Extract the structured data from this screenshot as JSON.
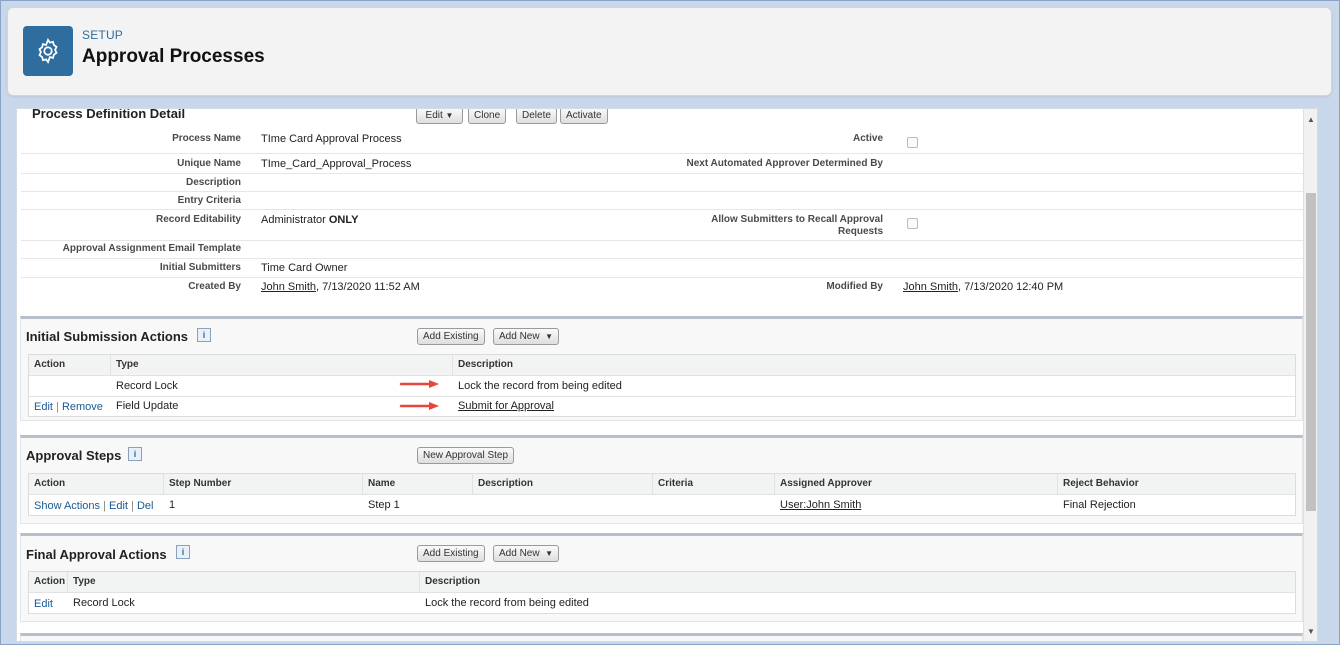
{
  "header": {
    "breadcrumb": "SETUP",
    "title": "Approval Processes",
    "icon": "gear-icon"
  },
  "detail": {
    "section_title": "Process Definition Detail",
    "buttons": {
      "edit": "Edit",
      "clone": "Clone",
      "delete": "Delete",
      "activate": "Activate"
    },
    "fields": {
      "process_name_label": "Process Name",
      "process_name": "TIme Card Approval Process",
      "active_label": "Active",
      "unique_name_label": "Unique Name",
      "unique_name": "TIme_Card_Approval_Process",
      "next_approver_label": "Next Automated Approver Determined By",
      "description_label": "Description",
      "entry_criteria_label": "Entry Criteria",
      "record_editability_label": "Record Editability",
      "record_editability_prefix": "Administrator",
      "record_editability_bold": "ONLY",
      "allow_recall_label_1": "Allow Submitters to Recall Approval",
      "allow_recall_label_2": "Requests",
      "email_template_label": "Approval Assignment Email Template",
      "initial_submitters_label": "Initial Submitters",
      "initial_submitters": "Time Card Owner",
      "created_by_label": "Created By",
      "created_by_name": "John Smith",
      "created_by_date": ", 7/13/2020 11:52 AM",
      "modified_by_label": "Modified By",
      "modified_by_name": "John Smith",
      "modified_by_date": ", 7/13/2020 12:40 PM"
    }
  },
  "initial_submission": {
    "title": "Initial Submission Actions",
    "info": "i",
    "add_existing": "Add Existing",
    "add_new": "Add New",
    "columns": [
      "Action",
      "Type",
      "Description"
    ],
    "rows": [
      {
        "type": "Record Lock",
        "description": "Lock the record from being edited"
      },
      {
        "edit": "Edit",
        "remove": "Remove",
        "type": "Field Update",
        "description": "Submit for Approval"
      }
    ]
  },
  "approval_steps": {
    "title": "Approval Steps",
    "info": "i",
    "new_step": "New Approval Step",
    "columns": [
      "Action",
      "Step Number",
      "Name",
      "Description",
      "Criteria",
      "Assigned Approver",
      "Reject Behavior"
    ],
    "row": {
      "show_actions": "Show Actions",
      "edit": "Edit",
      "del": "Del",
      "step_number": "1",
      "name": "Step 1",
      "approver": "User:John Smith",
      "reject": "Final Rejection"
    }
  },
  "final_approval": {
    "title": "Final Approval Actions",
    "info": "i",
    "add_existing": "Add Existing",
    "add_new": "Add New",
    "columns": [
      "Action",
      "Type",
      "Description"
    ],
    "row": {
      "edit": "Edit",
      "type": "Record Lock",
      "description": "Lock the record from being edited"
    }
  },
  "separator": "|",
  "dropdown_glyph": "▼",
  "scroll_up": "▲",
  "scroll_down": "▼",
  "colors": {
    "brand": "#2f6d9e",
    "link": "#1a5a96",
    "arrow": "#e8453c"
  }
}
